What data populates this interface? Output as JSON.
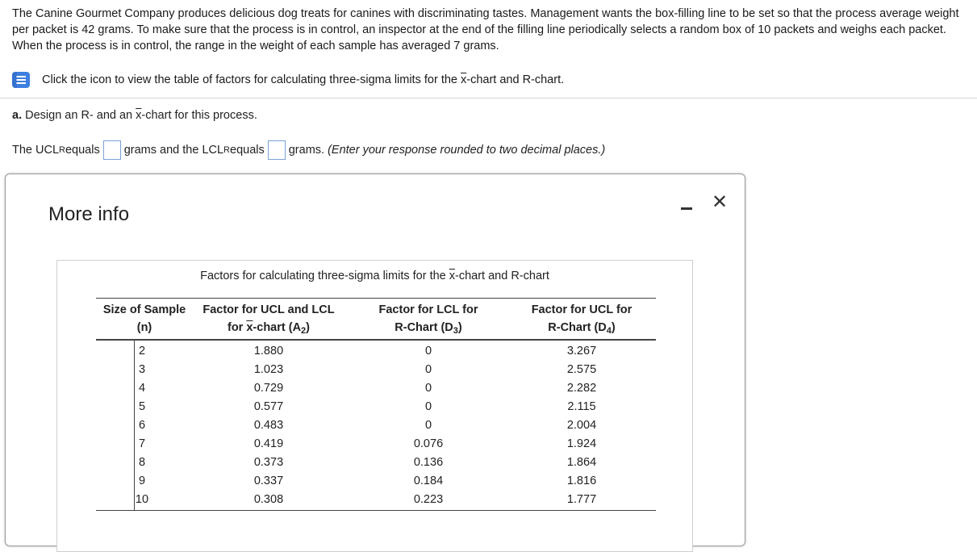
{
  "problem": {
    "text": "The Canine Gourmet Company produces delicious dog treats for canines with discriminating tastes. Management wants the box-filling line to be set so that the process average weight per packet is 42 grams. To make sure that the process is in control, an inspector at the end of the filling line periodically selects a random box of 10 packets and weighs each packet. When the process is in control, the range in the weight of each sample has averaged 7 grams."
  },
  "icon_link": {
    "pre": "Click the icon to view the table of factors for calculating three-sigma limits for the ",
    "xbar": "x",
    "post": "-chart and R-chart."
  },
  "part_a": {
    "label": "a.",
    "pre": " Design an R- and an ",
    "xbar": "x",
    "post": "-chart for this process."
  },
  "answer": {
    "t1": "The UCL",
    "sub1": "R",
    "t2": " equals",
    "t3": "grams and the LCL",
    "sub2": "R",
    "t4": " equals",
    "t5": "grams.",
    "hint": "(Enter your response rounded to two decimal places.)"
  },
  "modal": {
    "title": "More info",
    "minimize_icon": "minimize-icon",
    "close_icon": "close-icon",
    "close_glyph": "✕",
    "table_caption_pre": "Factors for calculating three-sigma limits for the ",
    "table_caption_xbar": "x",
    "table_caption_post": "-chart and R-chart",
    "headers": {
      "h1a": "Size of Sample",
      "h1b": "(n)",
      "h2a": "Factor for UCL and LCL",
      "h2b_pre": "for ",
      "h2b_xbar": "x",
      "h2b_post": "-chart (A",
      "h2b_sub": "2",
      "h2b_end": ")",
      "h3a": "Factor for LCL for",
      "h3b_pre": "R-Chart (D",
      "h3b_sub": "3",
      "h3b_end": ")",
      "h4a": "Factor for UCL for",
      "h4b_pre": "R-Chart (D",
      "h4b_sub": "4",
      "h4b_end": ")"
    },
    "rows": [
      {
        "n": "2",
        "a2": "1.880",
        "d3": "0",
        "d4": "3.267"
      },
      {
        "n": "3",
        "a2": "1.023",
        "d3": "0",
        "d4": "2.575"
      },
      {
        "n": "4",
        "a2": "0.729",
        "d3": "0",
        "d4": "2.282"
      },
      {
        "n": "5",
        "a2": "0.577",
        "d3": "0",
        "d4": "2.115"
      },
      {
        "n": "6",
        "a2": "0.483",
        "d3": "0",
        "d4": "2.004"
      },
      {
        "n": "7",
        "a2": "0.419",
        "d3": "0.076",
        "d4": "1.924"
      },
      {
        "n": "8",
        "a2": "0.373",
        "d3": "0.136",
        "d4": "1.864"
      },
      {
        "n": "9",
        "a2": "0.337",
        "d3": "0.184",
        "d4": "1.816"
      },
      {
        "n": "10",
        "a2": "0.308",
        "d3": "0.223",
        "d4": "1.777"
      }
    ]
  },
  "colors": {
    "icon_blue": "#3d7fe0",
    "input_border": "#7aa2d6"
  }
}
